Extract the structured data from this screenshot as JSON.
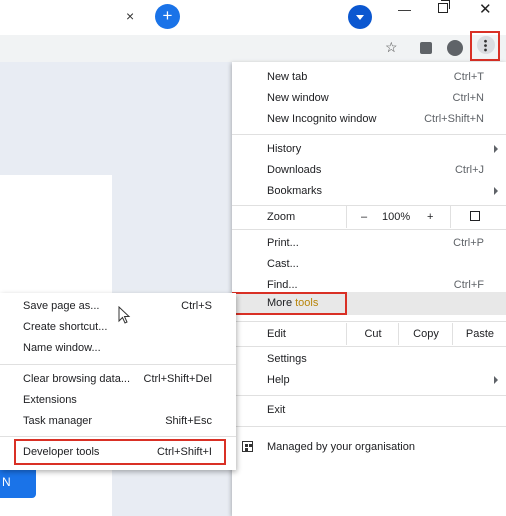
{
  "titlebar": {
    "tab_close": "×",
    "new_tab": "+",
    "minimize": "—",
    "close": "✕"
  },
  "page": {
    "button_label": "N"
  },
  "menu": {
    "new_tab": {
      "label": "New tab",
      "shortcut": "Ctrl+T"
    },
    "new_window": {
      "label": "New window",
      "shortcut": "Ctrl+N"
    },
    "new_incognito": {
      "label": "New Incognito window",
      "shortcut": "Ctrl+Shift+N"
    },
    "history": {
      "label": "History"
    },
    "downloads": {
      "label": "Downloads",
      "shortcut": "Ctrl+J"
    },
    "bookmarks": {
      "label": "Bookmarks"
    },
    "zoom": {
      "label": "Zoom",
      "minus": "–",
      "value": "100%",
      "plus": "+"
    },
    "print": {
      "label": "Print...",
      "shortcut": "Ctrl+P"
    },
    "cast": {
      "label": "Cast..."
    },
    "find": {
      "label": "Find...",
      "shortcut": "Ctrl+F"
    },
    "more_tools": {
      "label_prefix": "More ",
      "label_highlight": "tools"
    },
    "edit": {
      "label": "Edit",
      "cut": "Cut",
      "copy": "Copy",
      "paste": "Paste"
    },
    "settings": {
      "label": "Settings"
    },
    "help": {
      "label": "Help"
    },
    "exit": {
      "label": "Exit"
    },
    "managed": {
      "label": "Managed by your organisation"
    }
  },
  "submenu": {
    "items": [
      {
        "label": "Save page as...",
        "shortcut": "Ctrl+S"
      },
      {
        "label": "Create shortcut..."
      },
      {
        "label": "Name window..."
      },
      {
        "label": "Clear browsing data...",
        "shortcut": "Ctrl+Shift+Del"
      },
      {
        "label": "Extensions"
      },
      {
        "label": "Task manager",
        "shortcut": "Shift+Esc"
      },
      {
        "label": "Developer tools",
        "shortcut": "Ctrl+Shift+I"
      }
    ]
  },
  "colors": {
    "highlight_border": "#d93025",
    "accent_blue": "#1a73e8",
    "tools_text": "#b8860b"
  }
}
